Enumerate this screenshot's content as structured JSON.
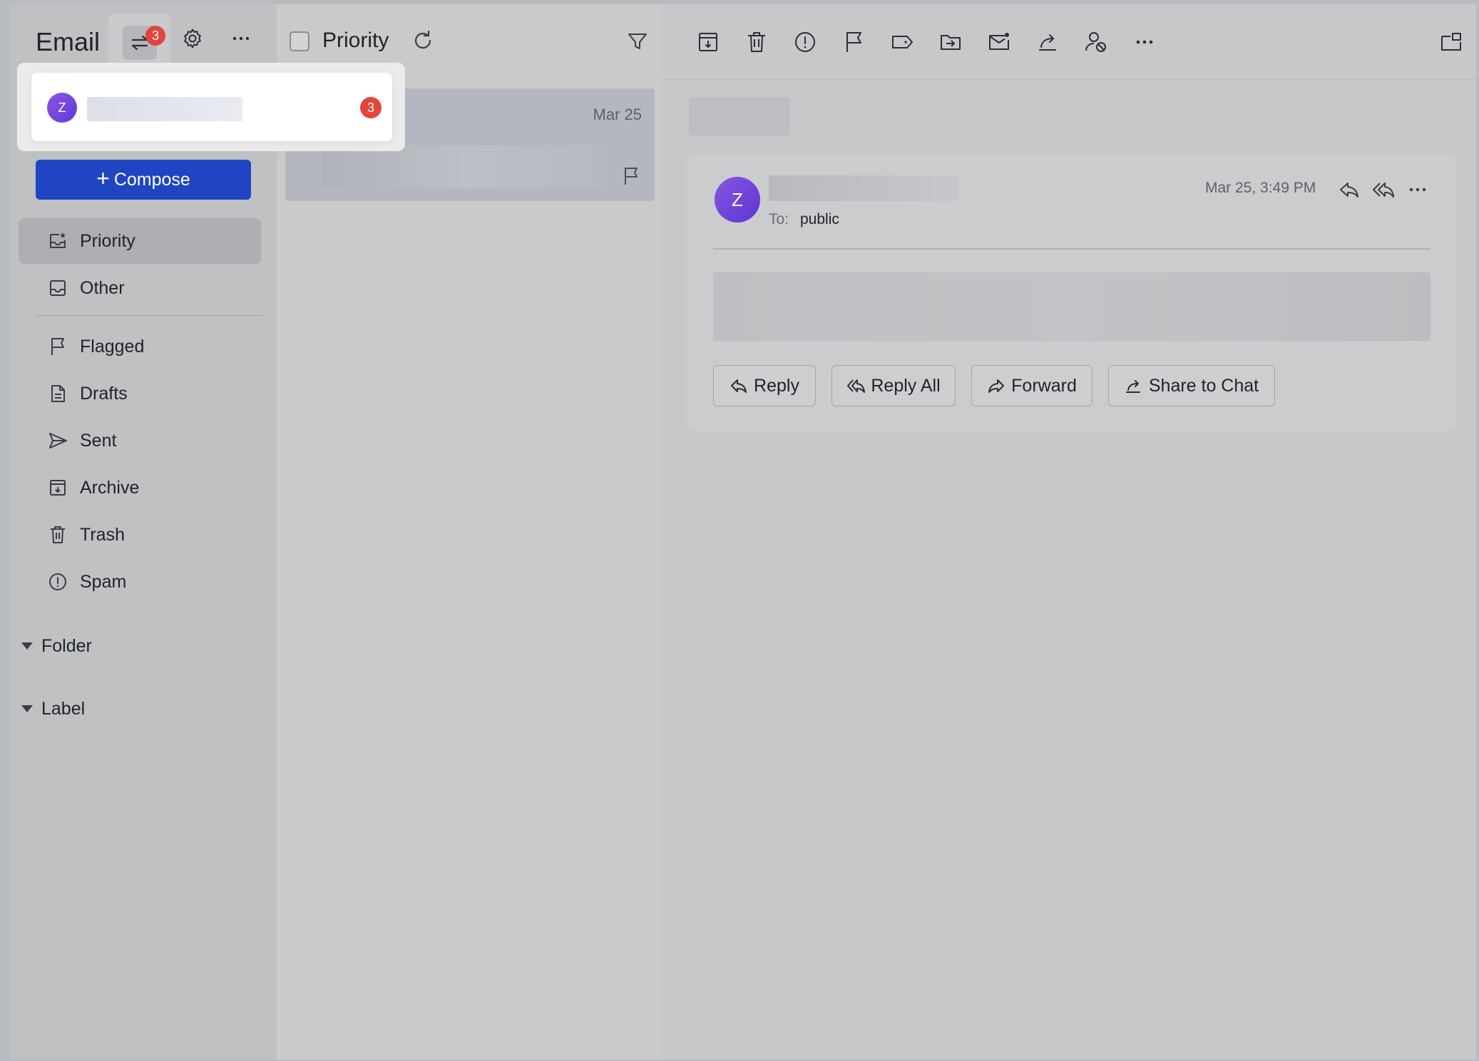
{
  "app": {
    "title": "Email",
    "account_badge_count": "3"
  },
  "popover": {
    "avatar_initial": "Z",
    "unread_count": "3"
  },
  "sidebar": {
    "compose_label": "Compose",
    "items": [
      {
        "label": "Priority",
        "icon": "priority-inbox-icon",
        "active": true
      },
      {
        "label": "Other",
        "icon": "inbox-icon"
      },
      {
        "label": "Flagged",
        "icon": "flag-icon"
      },
      {
        "label": "Drafts",
        "icon": "draft-icon"
      },
      {
        "label": "Sent",
        "icon": "send-icon"
      },
      {
        "label": "Archive",
        "icon": "archive-icon"
      },
      {
        "label": "Trash",
        "icon": "trash-icon"
      },
      {
        "label": "Spam",
        "icon": "spam-icon"
      }
    ],
    "groups": [
      {
        "label": "Folder"
      },
      {
        "label": "Label"
      }
    ]
  },
  "list": {
    "title": "Priority",
    "mails": [
      {
        "date": "Mar 25"
      }
    ]
  },
  "message": {
    "sender_initial": "Z",
    "to_label": "To:",
    "to_value": "public",
    "time": "Mar 25, 3:49 PM",
    "actions": {
      "reply": "Reply",
      "reply_all": "Reply All",
      "forward": "Forward",
      "share": "Share to Chat"
    }
  },
  "colors": {
    "accent": "#1f45c2",
    "badge": "#e0463b",
    "avatar": "#6b3fdc"
  }
}
